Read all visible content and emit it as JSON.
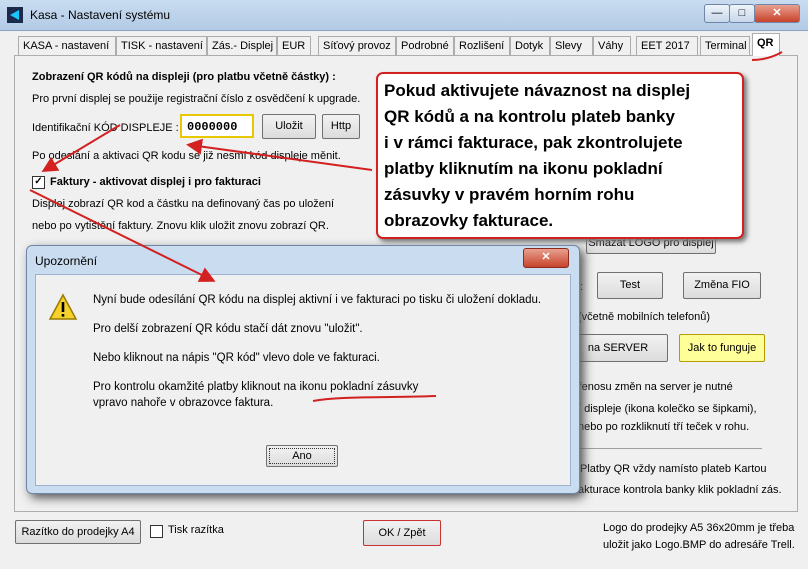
{
  "window": {
    "title": "Kasa - Nastavení systému",
    "min_label": "—",
    "max_label": "□",
    "close_label": "✕"
  },
  "tabs": [
    "KASA - nastavení",
    "TISK - nastavení",
    "Zás.- Displej",
    "EUR",
    "Síťový provoz",
    "Podrobné",
    "Rozlišení",
    "Dotyk",
    "Slevy",
    "Váhy",
    "EET 2017",
    "Terminal",
    "QR"
  ],
  "qr": {
    "section_title": "Zobrazení QR kódů na displeji (pro platbu včetně částky) :",
    "first_display_note": "Pro první displej se použije registrační číslo z osvědčení k upgrade.",
    "id_label": "Identifikační KÓD DISPLEJE :",
    "id_value": "0000000",
    "save_button": "Uložit",
    "http_button": "Http",
    "after_note": "Po odeslání a aktivaci QR kodu se již nesmí kód displeje měnit.",
    "invoice_checkbox_label": "Faktury - aktivovat displej i pro fakturaci",
    "display_note_1": "Displej zobrazí QR kod a částku na definovaný čas po uložení",
    "display_note_2": "nebo po vytištění faktury. Znovu klik uložit znovu zobrazí QR.",
    "delete_logo_button": "Smazat LOGO pro displej",
    "test_button": "Test",
    "fio_button": "Změna FIO",
    "mobile_note": "(včetně mobilních telefonů)",
    "server_button": "na SERVER",
    "howto_button": "Jak to funguje",
    "server_note_1": "řenosu změn na server je nutné",
    "server_note_2": "í displeje (ikona kolečko se šipkami),",
    "server_note_3": "nebo po rozkliknutí tří teček v rohu.",
    "payments_note_1": "Platby QR vždy namísto plateb Kartou",
    "payments_note_2": "akturace kontrola banky klik pokladní zás.",
    "stamp_button": "Razítko do prodejky A4",
    "stamp_print_label": "Tisk razítka",
    "ok_button": "OK / Zpět",
    "logo_note_1": "Logo do prodejky A5 36x20mm je třeba",
    "logo_note_2": "uložit jako Logo.BMP do adresáře Trell."
  },
  "callout": {
    "text": "Pokud aktivujete návaznost na displej\nQR kódů a na kontrolu plateb banky\ni v rámci fakturace, pak zkontrolujete\nplatby kliknutím na ikonu pokladní\nzásuvky v pravém horním rohu\nobrazovky fakturace."
  },
  "dialog": {
    "title": "Upozornění",
    "close_label": "✕",
    "line1": "Nyní bude odesílání QR kódu na displej aktivní i ve fakturaci po tisku či uložení dokladu.",
    "line2": "Pro delší zobrazení QR kódu stačí dát znovu \"uložit\".",
    "line3": "Nebo kliknout na nápis \"QR kód\" vlevo dole ve fakturaci.",
    "line4": "Pro kontrolu okamžité platby kliknout na ikonu pokladní zásuvky",
    "line5": "vpravo nahoře v obrazovce faktura.",
    "ok_button": "Ano"
  },
  "colors": {
    "annotation_red": "#d32020",
    "highlight_yellow": "#ffff99",
    "field_border": "#e8c800"
  }
}
